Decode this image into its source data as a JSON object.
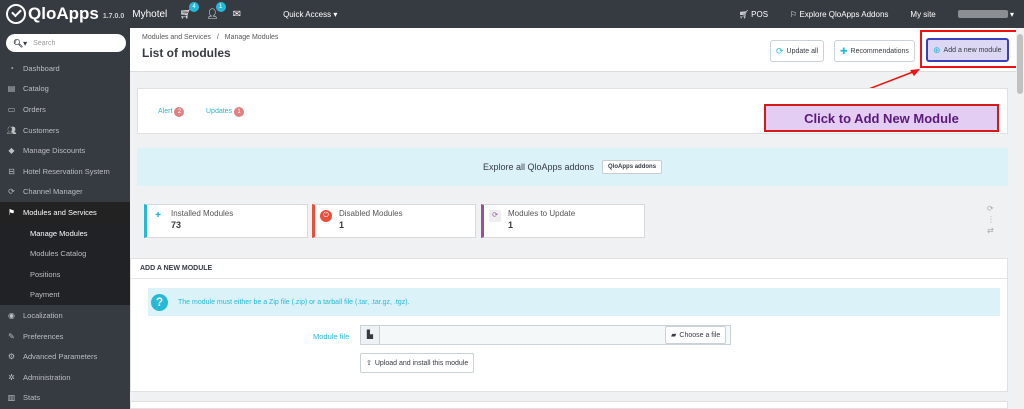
{
  "topbar": {
    "brand": "QloApps",
    "version": "1.7.0.0",
    "shop_name": "Myhotel",
    "cart_badge": "4",
    "user_badge": "1",
    "quick_access": "Quick Access ▾",
    "pos": "POS",
    "explore": "Explore QloApps Addons",
    "my_site": "My site"
  },
  "sidebar": {
    "search_placeholder": "Search",
    "items": [
      {
        "icon": "dashboard-icon",
        "label": "Dashboard"
      },
      {
        "icon": "catalog-icon",
        "label": "Catalog"
      },
      {
        "icon": "orders-icon",
        "label": "Orders"
      },
      {
        "icon": "customers-icon",
        "label": "Customers"
      },
      {
        "icon": "discounts-icon",
        "label": "Manage Discounts"
      },
      {
        "icon": "hotel-icon",
        "label": "Hotel Reservation System"
      },
      {
        "icon": "channel-icon",
        "label": "Channel Manager"
      },
      {
        "icon": "modules-icon",
        "label": "Modules and Services"
      },
      {
        "icon": "",
        "label": "Manage Modules"
      },
      {
        "icon": "",
        "label": "Modules Catalog"
      },
      {
        "icon": "",
        "label": "Positions"
      },
      {
        "icon": "",
        "label": "Payment"
      },
      {
        "icon": "localization-icon",
        "label": "Localization"
      },
      {
        "icon": "preferences-icon",
        "label": "Preferences"
      },
      {
        "icon": "advanced-icon",
        "label": "Advanced Parameters"
      },
      {
        "icon": "administration-icon",
        "label": "Administration"
      },
      {
        "icon": "stats-icon",
        "label": "Stats"
      }
    ]
  },
  "header": {
    "breadcrumb_parent": "Modules and Services",
    "breadcrumb_sep": "/",
    "breadcrumb_current": "Manage Modules",
    "title": "List of modules",
    "update_all": "Update all",
    "recommendations": "Recommendations",
    "add_new_module": "Add a new module"
  },
  "alerts": {
    "alert_label": "Alert",
    "alert_count": "2",
    "updates_label": "Updates",
    "updates_count": "1"
  },
  "callout": "Click to Add New Module",
  "explore_bar": {
    "text": "Explore all QloApps addons",
    "button": "QloApps addons"
  },
  "stats": [
    {
      "label": "Installed Modules",
      "value": "73",
      "color": "#25b9d7"
    },
    {
      "label": "Disabled Modules",
      "value": "1",
      "color": "#e84e3a"
    },
    {
      "label": "Modules to Update",
      "value": "1",
      "color": "#9b4f96"
    }
  ],
  "add_panel": {
    "heading": "ADD A NEW MODULE",
    "info": "The module must either be a Zip file (.zip) or a tarball file (.tar, .tar.gz, .tgz).",
    "file_label": "Module file",
    "choose": "Choose a file",
    "upload": "Upload and install this module"
  },
  "colors": {
    "accent": "#25b9d7",
    "sidebar": "#363a41",
    "highlight": "#e11111"
  }
}
